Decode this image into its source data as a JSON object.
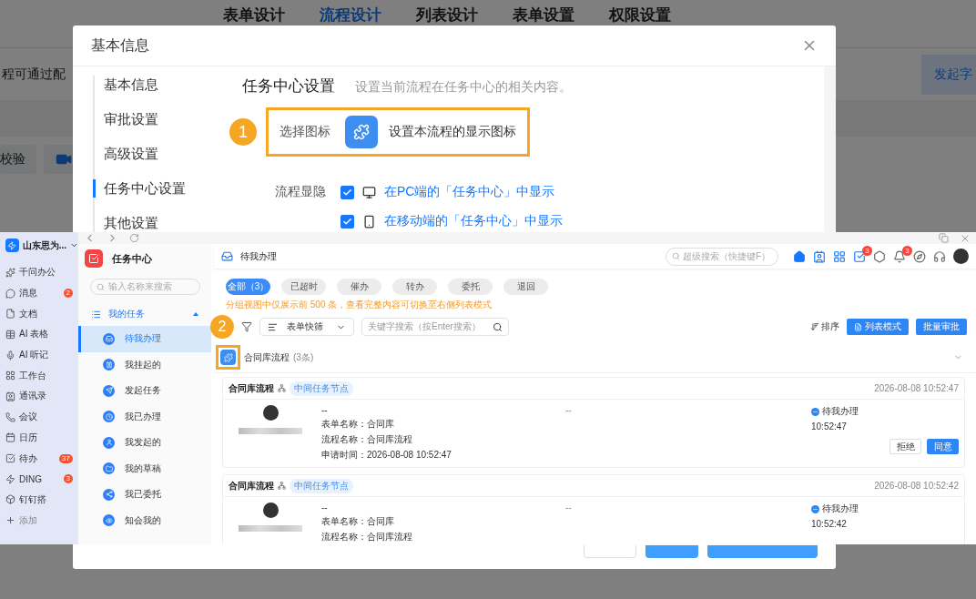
{
  "background_page": {
    "tabs": [
      {
        "label": "表单设计",
        "selected": false
      },
      {
        "label": "流程设计",
        "selected": true
      },
      {
        "label": "列表设计",
        "selected": false
      },
      {
        "label": "表单设置",
        "selected": false
      },
      {
        "label": "权限设置",
        "selected": false
      }
    ],
    "notice": "程可通过配",
    "start_button": "发起字",
    "verify_button": "校验"
  },
  "dialog": {
    "title": "基本信息",
    "nav": [
      {
        "label": "基本信息",
        "selected": false
      },
      {
        "label": "审批设置",
        "selected": false
      },
      {
        "label": "高级设置",
        "selected": false
      },
      {
        "label": "任务中心设置",
        "selected": true
      },
      {
        "label": "其他设置",
        "selected": false
      }
    ],
    "section": {
      "title": "任务中心设置",
      "description": "设置当前流程在任务中心的相关内容。"
    },
    "icon_row": {
      "step": "1",
      "label": "选择图标",
      "hint": "设置本流程的显示图标"
    },
    "visibility": {
      "label": "流程显隐",
      "options": [
        {
          "kind": "desktop",
          "text": "在PC端的「任务中心」中显示",
          "checked": true
        },
        {
          "kind": "mobile",
          "text": "在移动端的「任务中心」中显示",
          "checked": true
        }
      ]
    }
  },
  "overlay": {
    "org": "山东思为...",
    "nav": [
      {
        "label": "千问办公"
      },
      {
        "label": "消息",
        "badge": "2"
      },
      {
        "label": "文档"
      },
      {
        "label": "AI 表格"
      },
      {
        "label": "AI 听记"
      },
      {
        "label": "工作台"
      },
      {
        "label": "通讯录"
      },
      {
        "label": "会议"
      },
      {
        "label": "日历"
      },
      {
        "label": "待办",
        "badge": "37"
      },
      {
        "label": "DING",
        "badge": "3"
      },
      {
        "label": "钉钉搭"
      },
      {
        "label": "添加"
      }
    ],
    "app": {
      "title": "任务中心",
      "search_placeholder": "输入名称来搜索",
      "group": {
        "label": "我的任务",
        "expanded": true
      },
      "items": [
        {
          "label": "待我办理",
          "selected": true
        },
        {
          "label": "我挂起的",
          "selected": false
        },
        {
          "label": "发起任务",
          "selected": false
        },
        {
          "label": "我已办理",
          "selected": false
        },
        {
          "label": "我发起的",
          "selected": false
        },
        {
          "label": "我的草稿",
          "selected": false
        },
        {
          "label": "我已委托",
          "selected": false
        },
        {
          "label": "知会我的",
          "selected": false
        }
      ]
    },
    "header": {
      "title": "待我办理",
      "search_placeholder": "超级搜索（快捷键F）",
      "todo_badge": "3",
      "bell_badge": "3"
    },
    "filters": [
      {
        "label": "全部（3）",
        "selected": true
      },
      {
        "label": "已超时",
        "selected": false
      },
      {
        "label": "催办",
        "selected": false
      },
      {
        "label": "转办",
        "selected": false
      },
      {
        "label": "委托",
        "selected": false
      },
      {
        "label": "退回",
        "selected": false
      }
    ],
    "hint": "分组视图中仅展示前 500 条，查看完整内容可切换至右侧列表模式",
    "toolbar": {
      "step": "2",
      "quick_filter": "表单快筛",
      "keyword_placeholder": "关键字搜索（按Enter搜索）",
      "sort": "排序",
      "list_mode": "列表模式",
      "batch": "批量审批"
    },
    "group": {
      "name": "合同库流程",
      "count": "(3条)"
    },
    "cards": [
      {
        "title": "合同库流程",
        "tag": "中间任务节点",
        "time": "2026-08-08 10:52:47",
        "subject": "--",
        "fields": [
          "表单名称：合同库",
          "流程名称：合同库流程",
          "申请时间：2026-08-08 10:52:47"
        ],
        "column_2": "--",
        "status": "待我办理",
        "status_time": "10:52:47",
        "buttons": [
          "拒绝",
          "同意"
        ]
      },
      {
        "title": "合同库流程",
        "tag": "中间任务节点",
        "time": "2026-08-08 10:52:42",
        "subject": "--",
        "fields": [
          "表单名称：合同库",
          "流程名称：合同库流程"
        ],
        "column_2": "--",
        "status": "待我办理",
        "status_time": "10:52:42"
      }
    ]
  }
}
